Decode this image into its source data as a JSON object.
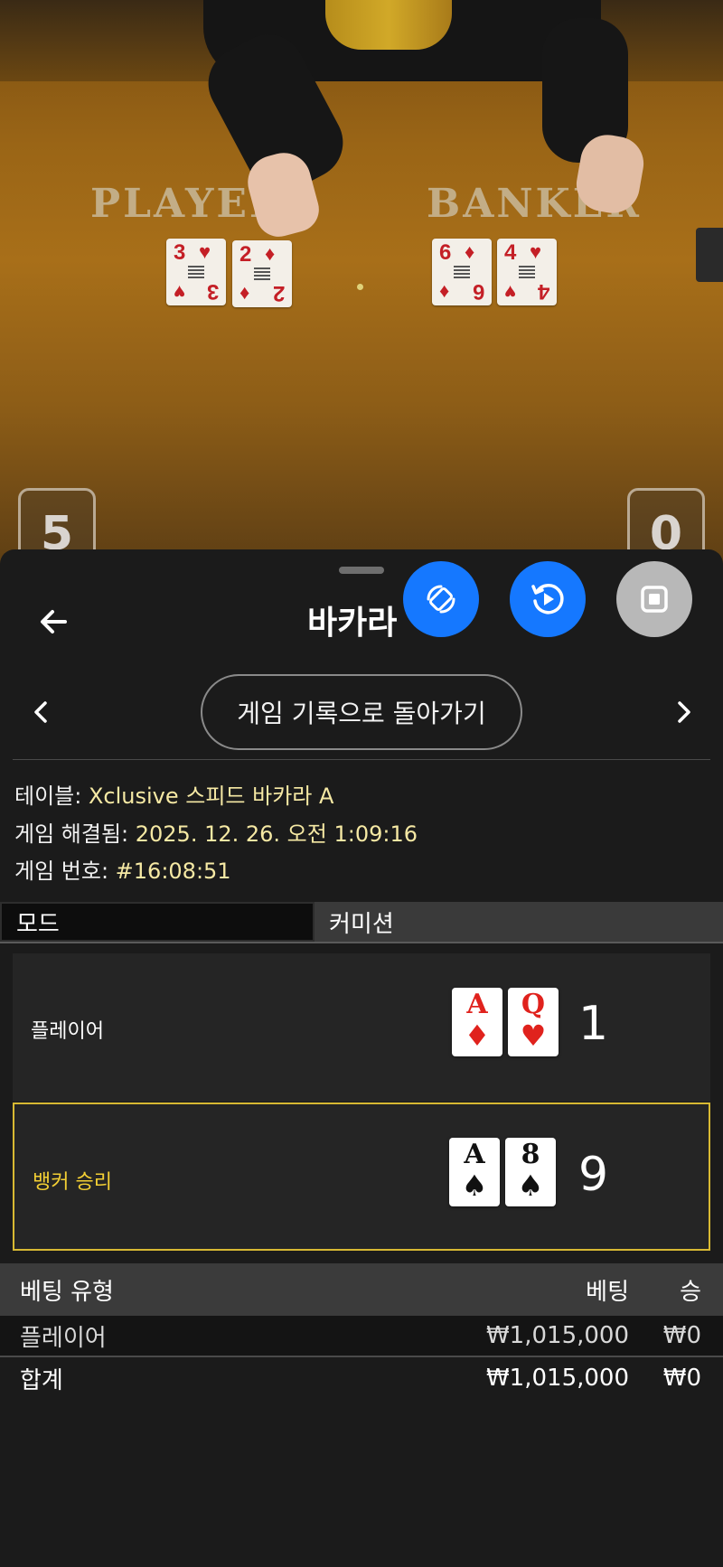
{
  "video": {
    "table_labels": {
      "player": "PLAYER",
      "banker": "BANKER"
    },
    "player_cards": [
      {
        "rank": "3",
        "suit": "♥"
      },
      {
        "rank": "2",
        "suit": "♦"
      }
    ],
    "banker_cards": [
      {
        "rank": "6",
        "suit": "♦"
      },
      {
        "rank": "4",
        "suit": "♥"
      }
    ],
    "score_player": "5",
    "score_banker": "0"
  },
  "header": {
    "title": "바카라",
    "buttons": {
      "back_icon": "arrow-left-icon",
      "rotate_icon": "rotate-icon",
      "replay_icon": "replay-icon",
      "pip_icon": "stop-icon"
    },
    "colors": {
      "blue": "#1578ff",
      "gray": "#b8b8b8"
    }
  },
  "nav": {
    "history_button": "게임 기록으로 돌아가기"
  },
  "info": {
    "table_label": "테이블: ",
    "table_value": "Xclusive 스피드 바카라 A",
    "resolved_label": "게임 해결됨: ",
    "resolved_value": "2025. 12. 26. 오전 1:09:16",
    "number_label": "게임 번호: ",
    "number_value": "#16:08:51"
  },
  "tabs": {
    "mode": "모드",
    "commission": "커미션"
  },
  "results": {
    "player": {
      "label": "플레이어",
      "cards": [
        {
          "rank": "A",
          "suit": "♦",
          "color": "red"
        },
        {
          "rank": "Q",
          "suit": "♥",
          "color": "red"
        }
      ],
      "score": "1"
    },
    "banker": {
      "label": "뱅커 승리",
      "cards": [
        {
          "rank": "A",
          "suit": "♠",
          "color": "black"
        },
        {
          "rank": "8",
          "suit": "♠",
          "color": "black"
        }
      ],
      "score": "9"
    },
    "highlight_color": "#d8b933"
  },
  "bets": {
    "headers": {
      "type": "베팅 유형",
      "bet": "베팅",
      "win": "승"
    },
    "rows": [
      {
        "type": "플레이어",
        "bet": "₩1,015,000",
        "win": "₩0"
      }
    ],
    "total": {
      "type": "합계",
      "bet": "₩1,015,000",
      "win": "₩0"
    }
  }
}
